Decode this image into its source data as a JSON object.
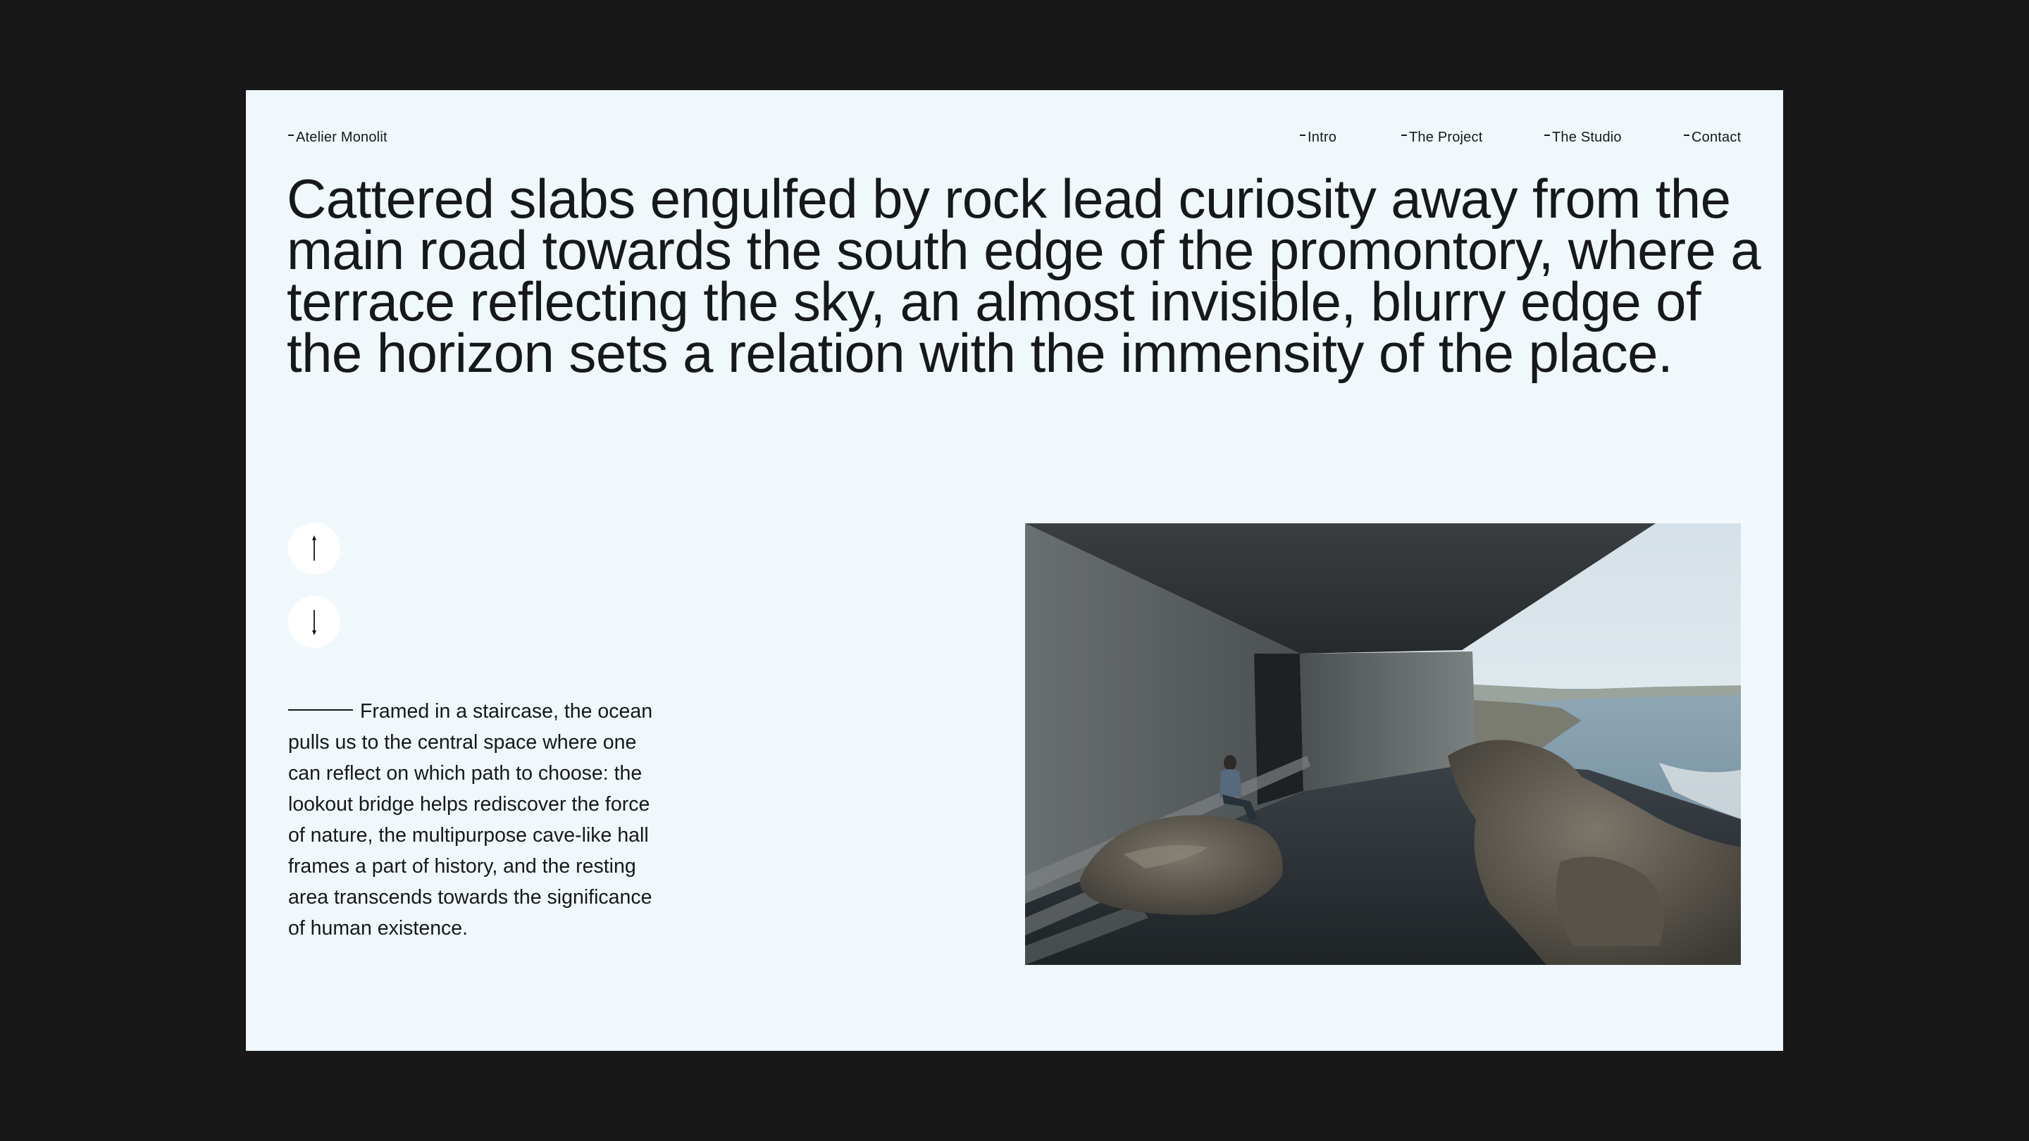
{
  "site": {
    "brand": "Atelier Monolit"
  },
  "nav": {
    "items": [
      {
        "label": "Intro"
      },
      {
        "label": "The Project"
      },
      {
        "label": "The Studio"
      },
      {
        "label": "Contact"
      }
    ]
  },
  "hero": {
    "headline": "Cattered slabs engulfed by rock lead curiosity away from the main road towards the south edge of the promontory, where a terrace reflecting the sky, an almost invisible, blurry edge of the horizon sets a relation with the immensity of the place."
  },
  "controls": {
    "up_icon": "arrow-up-icon",
    "down_icon": "arrow-down-icon"
  },
  "content": {
    "paragraph": "Framed in a staircase, the ocean pulls us to the central space where one can reflect on which path to choose: the lookout bridge helps rediscover the force of nature, the multipurpose cave-like hall frames a part of history, and the resting area transcends towards the significance of human existence."
  },
  "colors": {
    "backdrop": "#181818",
    "page": "#f1f8fc",
    "text": "#16181a",
    "button": "#ffffff"
  }
}
